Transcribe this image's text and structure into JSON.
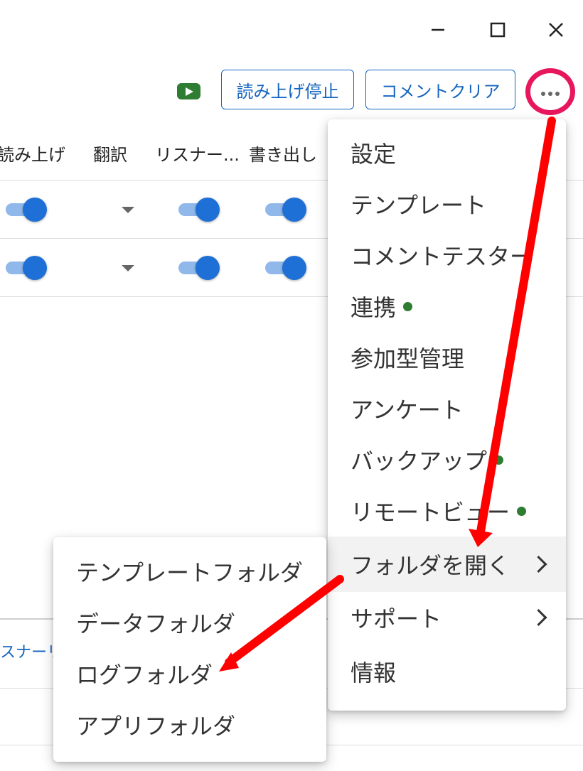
{
  "window_controls": {
    "minimize_icon": "minimize-icon",
    "maximize_icon": "maximize-icon",
    "close_icon": "close-icon"
  },
  "toolbar": {
    "youtube_icon": "youtube-icon",
    "stop_reading_label": "読み上げ停止",
    "clear_comments_label": "コメントクリア",
    "more_icon": "more-horizontal-icon"
  },
  "table": {
    "columns": [
      "読み上げ",
      "翻訳",
      "リスナー...",
      "書き出し"
    ],
    "rows": [
      {
        "read_aloud": true,
        "translate": "",
        "listener": true,
        "export": true
      },
      {
        "read_aloud": true,
        "translate": "",
        "listener": true,
        "export": true
      }
    ]
  },
  "lower_panel": {
    "partial_link": "スナーリ"
  },
  "main_menu": {
    "items": [
      {
        "label": "設定"
      },
      {
        "label": "テンプレート"
      },
      {
        "label": "コメントテスター"
      },
      {
        "label": "連携",
        "dot": true
      },
      {
        "label": "参加型管理"
      },
      {
        "label": "アンケート"
      },
      {
        "label": "バックアップ",
        "dot": true
      },
      {
        "label": "リモートビュー",
        "dot": true
      },
      {
        "label": "フォルダを開く",
        "submenu": true,
        "active": true
      },
      {
        "label": "サポート",
        "submenu": true
      },
      {
        "label": "情報"
      }
    ]
  },
  "folder_submenu": {
    "items": [
      {
        "label": "テンプレートフォルダ"
      },
      {
        "label": "データフォルダ"
      },
      {
        "label": "ログフォルダ"
      },
      {
        "label": "アプリフォルダ"
      }
    ]
  },
  "colors": {
    "accent": "#1565c0",
    "highlight_circle": "#e8175d",
    "annotation_arrow": "#ff0000",
    "status_dot": "#2e7d32",
    "toggle_knob": "#1e6fd6"
  }
}
